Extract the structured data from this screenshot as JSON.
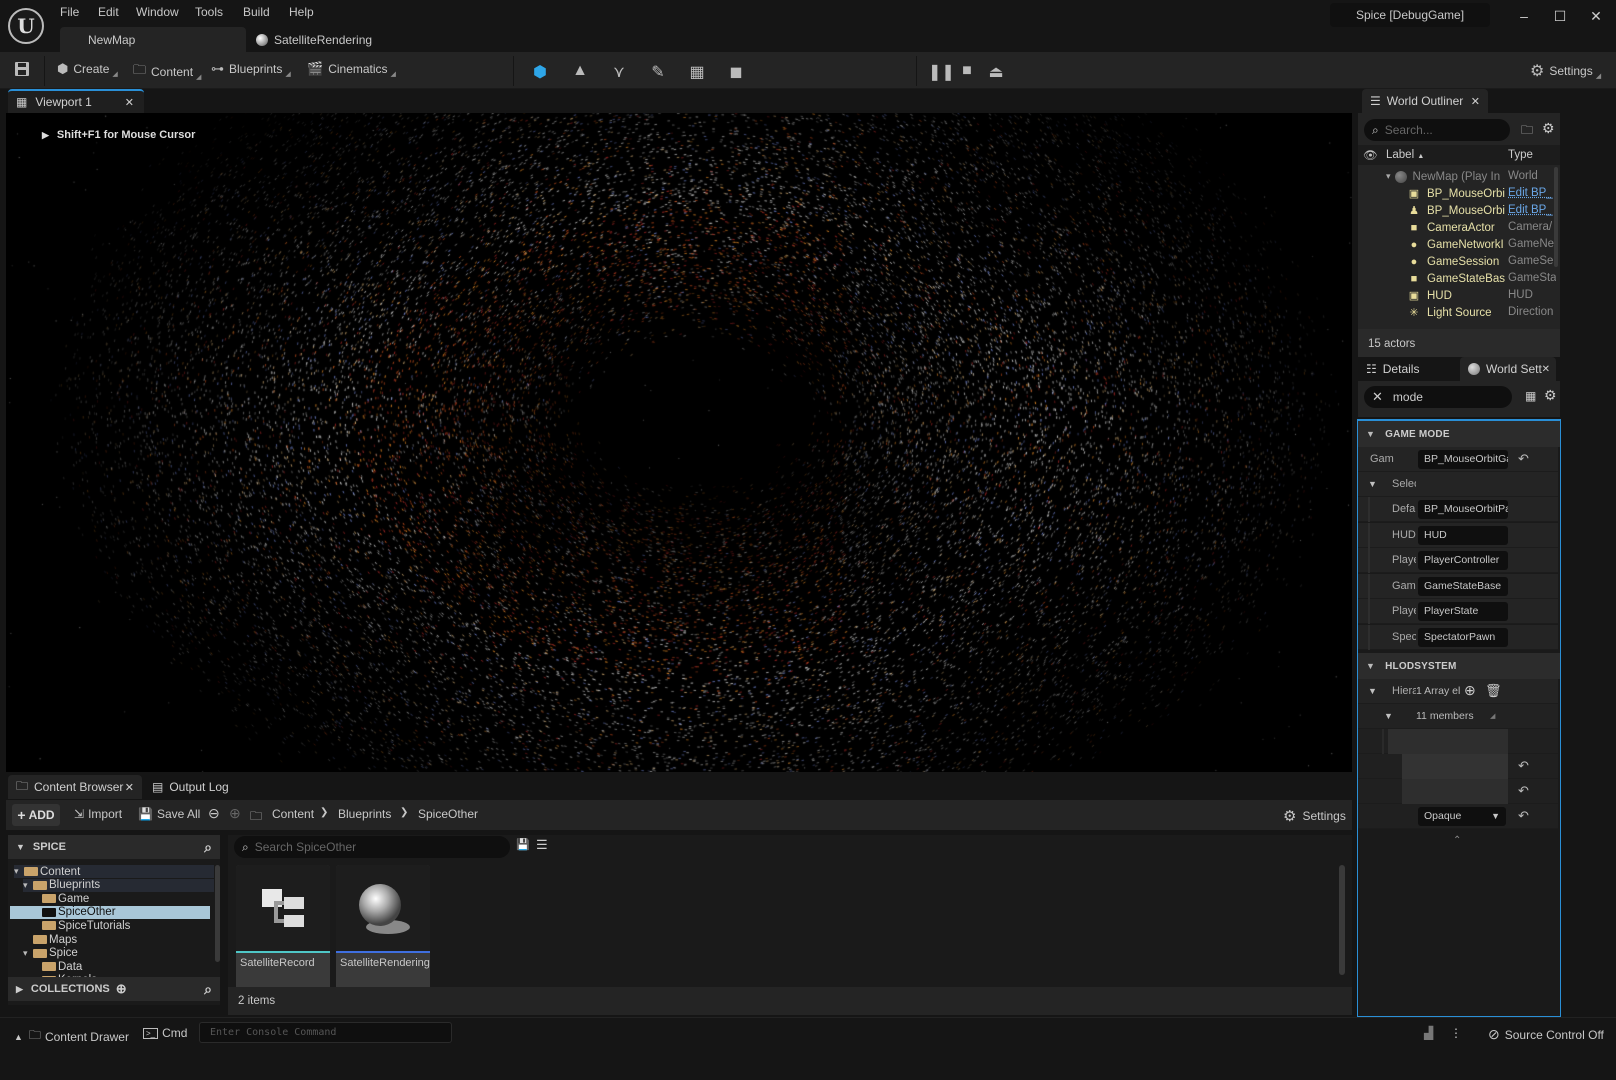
{
  "window": {
    "project_title": "Spice [DebugGame]",
    "controls": {
      "minimize": "–",
      "maximize": "☐",
      "close": "✕"
    }
  },
  "menu": [
    "File",
    "Edit",
    "Window",
    "Tools",
    "Build",
    "Help"
  ],
  "document_tabs": [
    {
      "label": "NewMap",
      "active": true
    },
    {
      "label": "SatelliteRendering",
      "active": false
    }
  ],
  "toolbar": {
    "create": "Create",
    "content": "Content",
    "blueprints": "Blueprints",
    "cinematics": "Cinematics",
    "modes": [
      "select-mode",
      "landscape-mode",
      "foliage-mode",
      "mesh-paint-mode",
      "fracture-mode",
      "brush-edit-mode"
    ],
    "play_controls": [
      "pause",
      "stop",
      "eject"
    ],
    "settings": "Settings"
  },
  "viewport": {
    "tab_label": "Viewport 1",
    "hint": "Shift+F1 for Mouse Cursor"
  },
  "world_outliner": {
    "tab_label": "World Outliner",
    "search_placeholder": "Search...",
    "col_label": "Label",
    "col_type": "Type",
    "root": {
      "label": "NewMap (Play In",
      "type": "World"
    },
    "items": [
      {
        "label": "BP_MouseOrbi",
        "type": "Edit BP_",
        "icon": "hud-icon",
        "link": true
      },
      {
        "label": "BP_MouseOrbi",
        "type": "Edit BP_",
        "icon": "pawn-icon",
        "link": true
      },
      {
        "label": "CameraActor",
        "type": "Camera/",
        "icon": "camera-icon",
        "link": false
      },
      {
        "label": "GameNetworkI",
        "type": "GameNe",
        "icon": "actor-icon",
        "link": false
      },
      {
        "label": "GameSession",
        "type": "GameSe",
        "icon": "actor-icon",
        "link": false
      },
      {
        "label": "GameStateBas",
        "type": "GameSta",
        "icon": "state-icon",
        "link": false
      },
      {
        "label": "HUD",
        "type": "HUD",
        "icon": "hud-icon",
        "link": false
      },
      {
        "label": "Light Source",
        "type": "Direction",
        "icon": "light-icon",
        "link": false
      }
    ],
    "actor_count": "15 actors"
  },
  "details": {
    "tab_details": "Details",
    "tab_world_settings": "World Sett",
    "search_value": "mode",
    "game_mode": {
      "header": "GAME MODE",
      "game_mode_override": {
        "name": "GameM",
        "value": "BP_MouseOrbitGa"
      },
      "selected_group": "Selec",
      "rows": [
        {
          "name": "Defa",
          "value": "BP_MouseOrbitPa"
        },
        {
          "name": "HUD",
          "value": "HUD"
        },
        {
          "name": "Playe",
          "value": "PlayerController"
        },
        {
          "name": "Gam",
          "value": "GameStateBase"
        },
        {
          "name": "Playe",
          "value": "PlayerState"
        },
        {
          "name": "Spec",
          "value": "SpectatorPawn"
        }
      ]
    },
    "hlod": {
      "header": "HLODSYSTEM",
      "hierarchy_name": "Hiera",
      "array_text": "1 Array el",
      "members_text": "11 members",
      "blend_mode": "Opaque"
    }
  },
  "content_browser": {
    "tab_label": "Content Browser",
    "output_log_label": "Output Log",
    "add": "ADD",
    "import": "Import",
    "save_all": "Save All",
    "breadcrumb": [
      "Content",
      "Blueprints",
      "SpiceOther"
    ],
    "settings": "Settings",
    "tree_header": "SPICE",
    "tree": [
      {
        "label": "Content",
        "depth": 0,
        "expanded": true
      },
      {
        "label": "Blueprints",
        "depth": 1,
        "expanded": true
      },
      {
        "label": "Game",
        "depth": 2
      },
      {
        "label": "SpiceOther",
        "depth": 2,
        "selected": true
      },
      {
        "label": "SpiceTutorials",
        "depth": 2
      },
      {
        "label": "Maps",
        "depth": 1
      },
      {
        "label": "Spice",
        "depth": 1,
        "expanded": true
      },
      {
        "label": "Data",
        "depth": 2
      },
      {
        "label": "Kernels",
        "depth": 2,
        "collapsed": true
      }
    ],
    "collections_header": "COLLECTIONS",
    "search_placeholder": "Search SpiceOther",
    "assets": [
      {
        "name": "SatelliteRecord",
        "type_color": "#4fc7c7"
      },
      {
        "name": "SatelliteRendering",
        "type_color": "#3f6fe0"
      }
    ],
    "item_count": "2 items"
  },
  "status_bar": {
    "content_drawer": "Content Drawer",
    "cmd": "Cmd",
    "console_placeholder": "Enter Console Command",
    "source_control": "Source Control Off"
  },
  "colors": {
    "accent_blue": "#2a8fd6",
    "outliner_actor": "#e6e0a8",
    "link": "#6aa7e8",
    "selected_tree": "#a9c7d8"
  }
}
